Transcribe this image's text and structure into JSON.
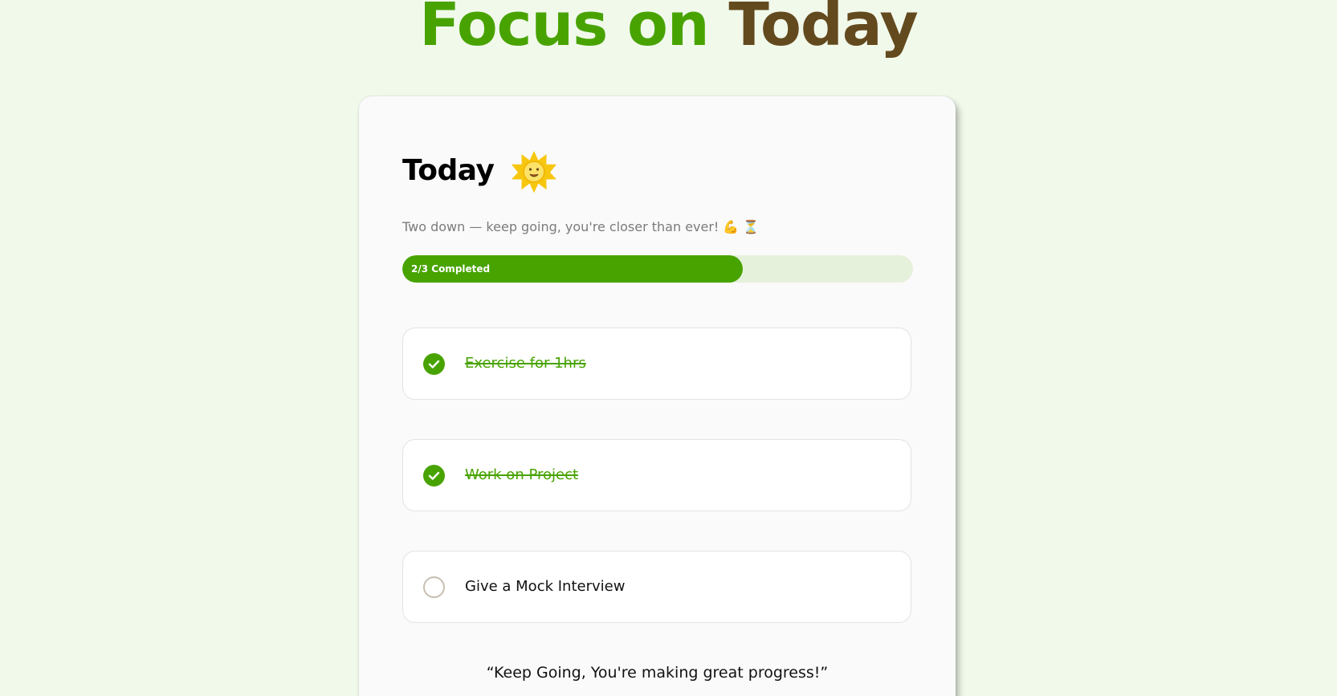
{
  "header": {
    "title_part1": "Focus on",
    "title_part2": "Today",
    "color_part1": "#48a300",
    "color_part2": "#634a1e"
  },
  "card": {
    "title": "Today",
    "title_icon": "sun-icon",
    "subtitle": "Two down — keep going, you're closer than ever! 💪 ⏳",
    "progress": {
      "label": "2/3 Completed",
      "completed": 2,
      "total": 3,
      "fill_color": "#48a300",
      "track_color": "#e6f1dc"
    },
    "tasks": [
      {
        "label": "Exercise for 1hrs",
        "completed": true
      },
      {
        "label": "Work on Project",
        "completed": true
      },
      {
        "label": "Give a Mock Interview",
        "completed": false
      }
    ],
    "quote": "“Keep Going, You're making great progress!”"
  }
}
